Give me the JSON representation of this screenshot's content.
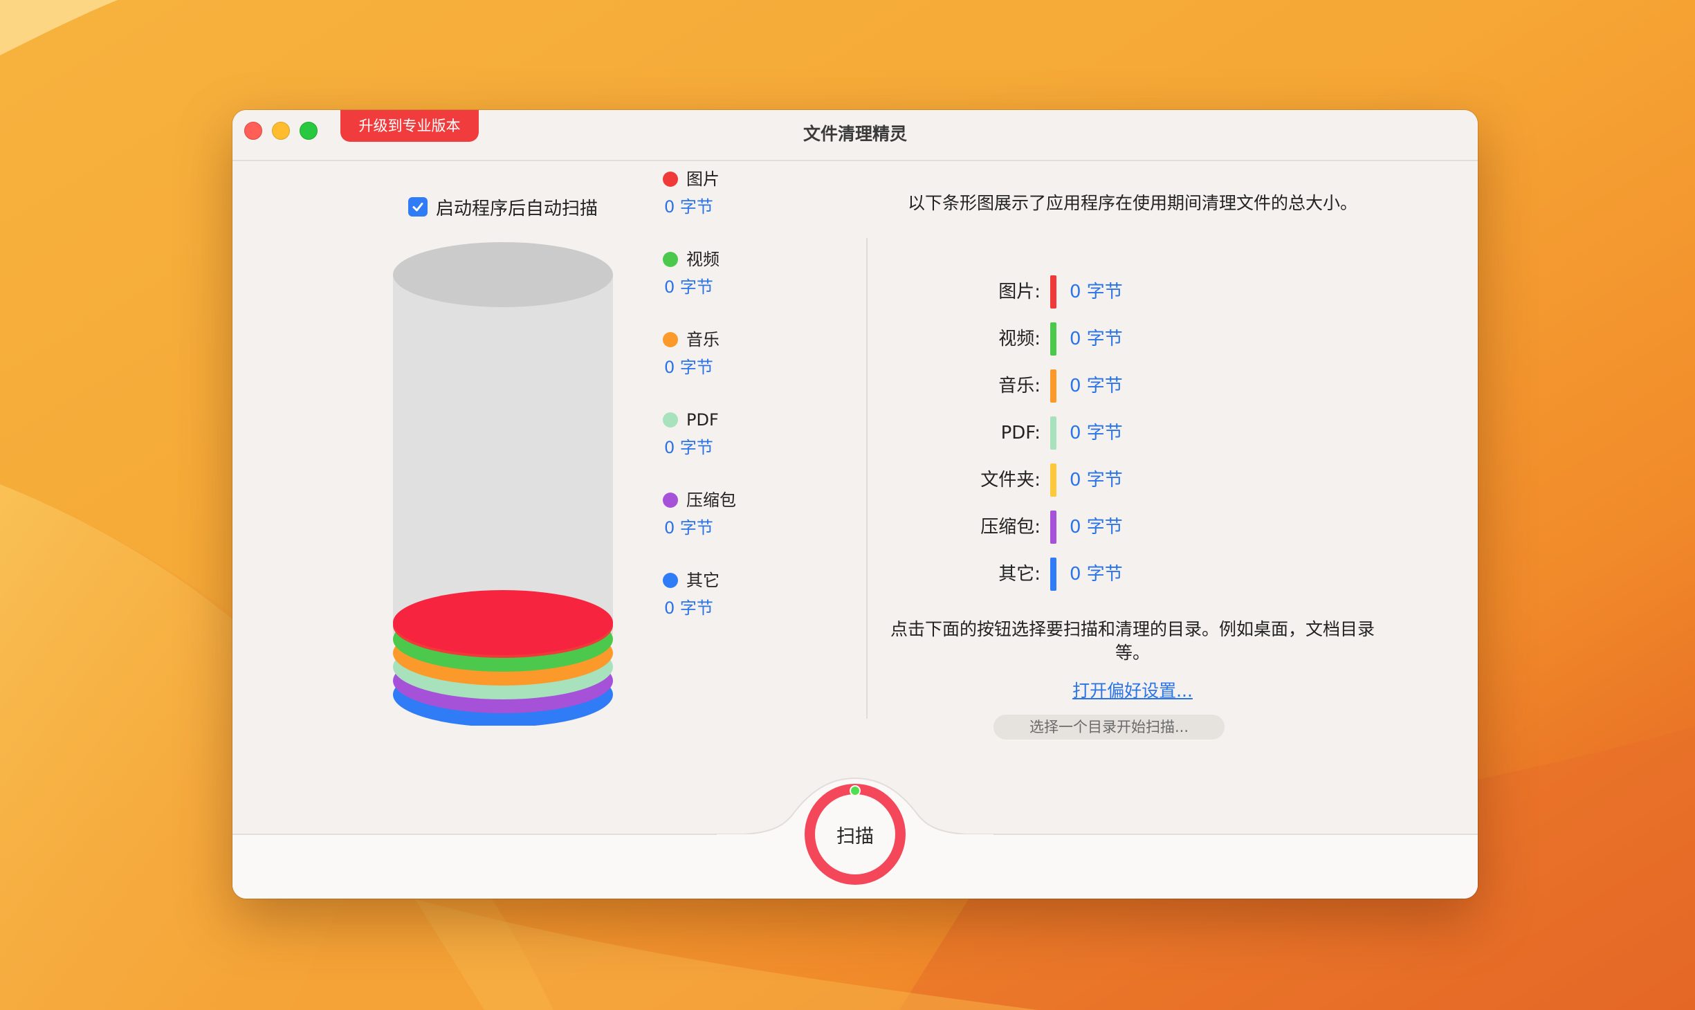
{
  "window": {
    "title": "文件清理精灵",
    "upgrade_label": "升级到专业版本"
  },
  "autoscan": {
    "label": "启动程序后自动扫描",
    "checked": true
  },
  "legend": [
    {
      "name": "图片",
      "value": "0 字节",
      "color": "#f03a3a"
    },
    {
      "name": "视频",
      "value": "0 字节",
      "color": "#4cc94c"
    },
    {
      "name": "音乐",
      "value": "0 字节",
      "color": "#fb9a2a"
    },
    {
      "name": "PDF",
      "value": "0 字节",
      "color": "#a8e2bd"
    },
    {
      "name": "压缩包",
      "value": "0 字节",
      "color": "#a552d8"
    },
    {
      "name": "其它",
      "value": "0 字节",
      "color": "#2f7cf6"
    }
  ],
  "description": "以下条形图展示了应用程序在使用期间清理文件的总大小。",
  "stats": [
    {
      "label": "图片:",
      "value": "0 字节",
      "color": "#f03a3a"
    },
    {
      "label": "视频:",
      "value": "0 字节",
      "color": "#4cc94c"
    },
    {
      "label": "音乐:",
      "value": "0 字节",
      "color": "#fb9a2a"
    },
    {
      "label": "PDF:",
      "value": "0 字节",
      "color": "#a8e2bd"
    },
    {
      "label": "文件夹:",
      "value": "0 字节",
      "color": "#fdc83a"
    },
    {
      "label": "压缩包:",
      "value": "0 字节",
      "color": "#a552d8"
    },
    {
      "label": "其它:",
      "value": "0 字节",
      "color": "#2f7cf6"
    }
  ],
  "hint": "点击下面的按钮选择要扫描和清理的目录。例如桌面，文档目录等。",
  "preferences_link": "打开偏好设置...",
  "choose_directory_label": "选择一个目录开始扫描...",
  "scan_label": "扫描",
  "colors": {
    "accent": "#2f7cf6",
    "scan_ring": "#f4485a",
    "upgrade": "#f03c3c"
  }
}
